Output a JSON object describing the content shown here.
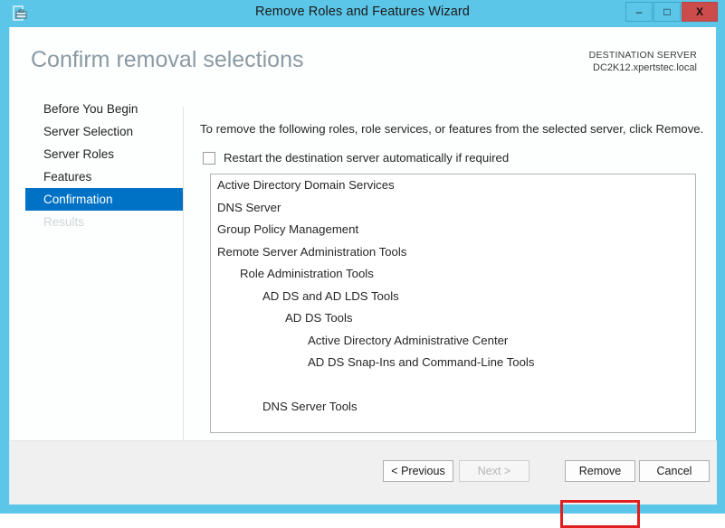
{
  "window": {
    "title": "Remove Roles and Features Wizard",
    "icon": "server-tools-icon",
    "controls": {
      "minimize": "–",
      "maximize": "□",
      "close": "X"
    },
    "titlebar_color": "#5cc6e8",
    "close_color": "#cc4b4b"
  },
  "header": {
    "page_title": "Confirm removal selections",
    "destination_label": "DESTINATION SERVER",
    "destination_value": "DC2K12.xpertstec.local"
  },
  "sidebar": {
    "items": [
      {
        "label": "Before You Begin",
        "state": "normal"
      },
      {
        "label": "Server Selection",
        "state": "normal"
      },
      {
        "label": "Server Roles",
        "state": "normal"
      },
      {
        "label": "Features",
        "state": "normal"
      },
      {
        "label": "Confirmation",
        "state": "selected"
      },
      {
        "label": "Results",
        "state": "disabled"
      }
    ],
    "selected_color": "#0072c6"
  },
  "main": {
    "instruction": "To remove the following roles, role services, or features from the selected server, click Remove.",
    "restart_checkbox": {
      "label": "Restart the destination server automatically if required",
      "checked": false
    },
    "removal_list": [
      {
        "label": "Active Directory Domain Services",
        "indent": 0,
        "spaced": false
      },
      {
        "label": "DNS Server",
        "indent": 0,
        "spaced": false
      },
      {
        "label": "Group Policy Management",
        "indent": 0,
        "spaced": false
      },
      {
        "label": "Remote Server Administration Tools",
        "indent": 0,
        "spaced": false
      },
      {
        "label": "Role Administration Tools",
        "indent": 1,
        "spaced": false
      },
      {
        "label": "AD DS and AD LDS Tools",
        "indent": 2,
        "spaced": false
      },
      {
        "label": "AD DS Tools",
        "indent": 3,
        "spaced": false
      },
      {
        "label": "Active Directory Administrative Center",
        "indent": 4,
        "spaced": false
      },
      {
        "label": "AD DS Snap-Ins and Command-Line Tools",
        "indent": 4,
        "spaced": false
      },
      {
        "label": "DNS Server Tools",
        "indent": 2,
        "spaced": true
      }
    ]
  },
  "footer": {
    "previous_label": "< Previous",
    "next_label": "Next >",
    "remove_label": "Remove",
    "cancel_label": "Cancel",
    "next_enabled": false,
    "annotation_color": "#e02020"
  }
}
